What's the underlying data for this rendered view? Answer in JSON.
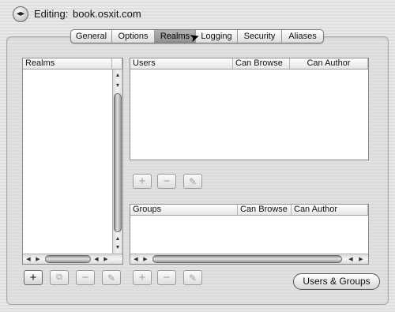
{
  "header": {
    "back_icon": "back-forward-icon",
    "editing_label": "Editing:",
    "host": "book.osxit.com"
  },
  "tabs": [
    {
      "label": "General",
      "selected": false
    },
    {
      "label": "Options",
      "selected": false
    },
    {
      "label": "Realms",
      "selected": true
    },
    {
      "label": "Logging",
      "selected": false
    },
    {
      "label": "Security",
      "selected": false
    },
    {
      "label": "Aliases",
      "selected": false
    }
  ],
  "realms": {
    "header": "Realms",
    "items": []
  },
  "users": {
    "columns": [
      "Users",
      "Can Browse",
      "Can Author"
    ],
    "rows": []
  },
  "groups": {
    "columns": [
      "Groups",
      "Can Browse",
      "Can Author"
    ],
    "rows": []
  },
  "buttons": {
    "add": "+",
    "remove": "−",
    "duplicate_icon": "duplicate-icon",
    "edit_icon": "pencil-icon",
    "users_groups": "Users & Groups"
  }
}
